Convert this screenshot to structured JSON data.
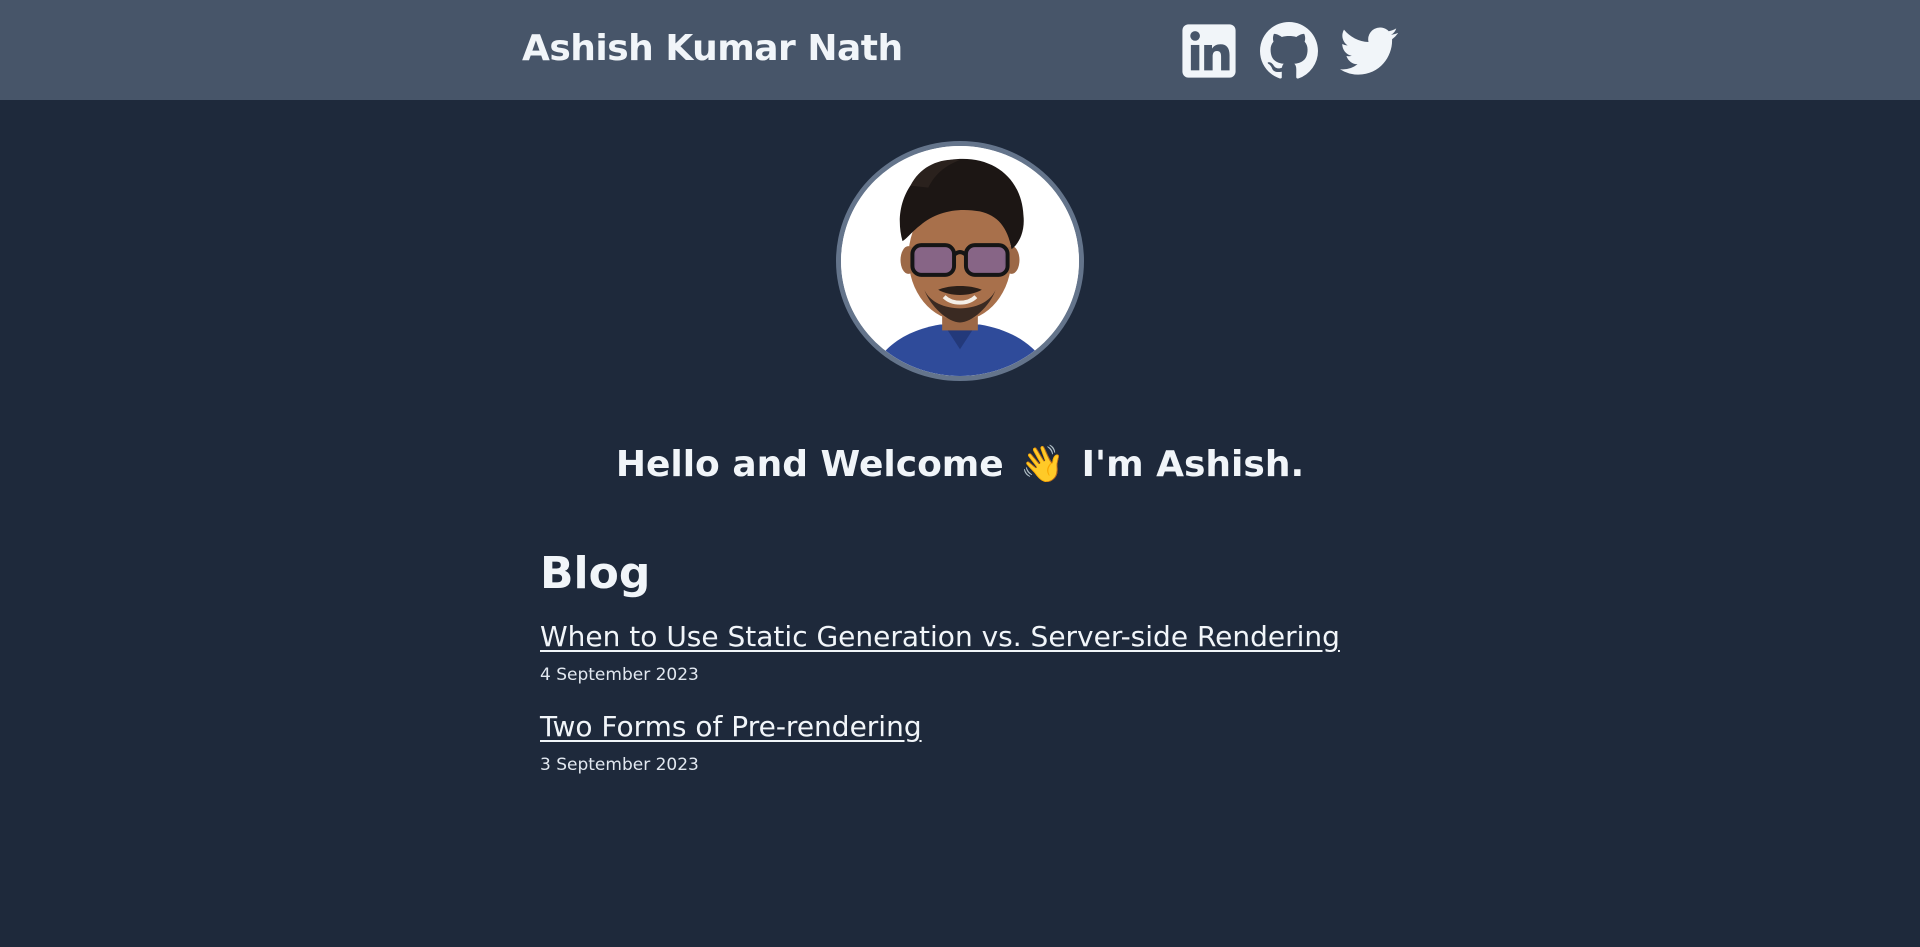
{
  "header": {
    "site_title": "Ashish Kumar Nath",
    "socials": [
      {
        "name": "linkedin",
        "icon": "linkedin-icon"
      },
      {
        "name": "github",
        "icon": "github-icon"
      },
      {
        "name": "twitter",
        "icon": "twitter-icon"
      }
    ]
  },
  "profile": {
    "avatar_icon": "profile-photo",
    "greeting_prefix": "Hello and Welcome",
    "greeting_emoji": "👋",
    "greeting_mid": "I'm",
    "greeting_name": "Ashish",
    "greeting_suffix": "."
  },
  "blog": {
    "heading": "Blog",
    "posts": [
      {
        "title": "When to Use Static Generation vs. Server-side Rendering",
        "date": "4 September 2023"
      },
      {
        "title": "Two Forms of Pre-rendering",
        "date": "3 September 2023"
      }
    ]
  },
  "colors": {
    "background": "#1e293b",
    "header": "#475569",
    "avatar_border": "#64748b",
    "text": "#f1f5f9"
  }
}
